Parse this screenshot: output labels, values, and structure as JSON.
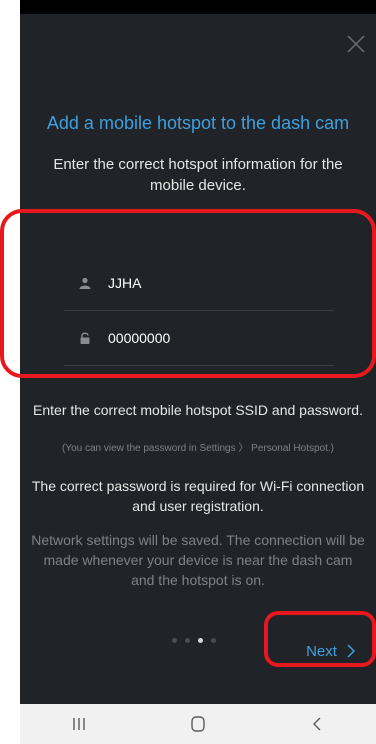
{
  "status_bar": {
    "time": "",
    "icons": ""
  },
  "header": {
    "close_icon": "close-icon"
  },
  "content": {
    "title": "Add a mobile hotspot to the dash cam",
    "subtitle": "Enter the correct hotspot information for the mobile device.",
    "ssid_field": {
      "icon": "person-icon",
      "value": "JJHA"
    },
    "password_field": {
      "icon": "lock-icon",
      "value": "00000000"
    },
    "info_ssid": "Enter the correct mobile hotspot SSID and password.",
    "info_hint": "(You can view the password in Settings 〉 Personal Hotspot.)",
    "info_password": "The correct password is required for Wi-Fi connection and user registration.",
    "info_network": "Network settings will be saved. The connection will be made whenever your device is near the dash cam and the hotspot is on."
  },
  "pager": {
    "total": 4,
    "current": 3
  },
  "footer": {
    "next_label": "Next",
    "next_icon": "chevron-right-icon"
  },
  "nav_bar": {
    "recents_icon": "recents-icon",
    "home_icon": "home-icon",
    "back_icon": "back-icon"
  },
  "colors": {
    "background": "#202328",
    "accent": "#3fa0df",
    "highlight": "#e8191e",
    "nav_bar": "#f1f1f1"
  }
}
